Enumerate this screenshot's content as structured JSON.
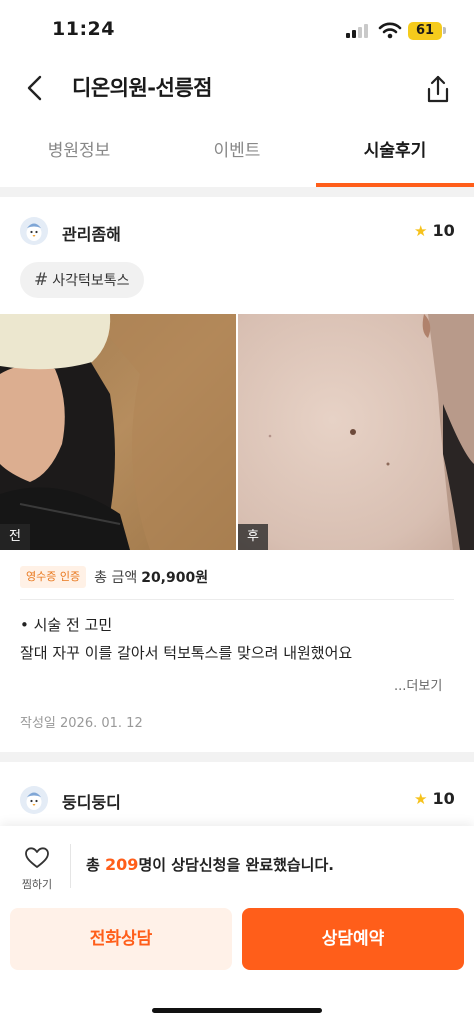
{
  "status_bar": {
    "time": "11:24",
    "battery": "61",
    "battery_color": "#f5cb1c"
  },
  "header": {
    "title": "디온의원-선릉점",
    "back_icon": "chevron-left-icon",
    "share_icon": "share-icon"
  },
  "tabs": [
    {
      "label": "병원정보",
      "active": false
    },
    {
      "label": "이벤트",
      "active": false
    },
    {
      "label": "시술후기",
      "active": true
    }
  ],
  "accent_color": "#ff5e1a",
  "reviews": [
    {
      "author": "관리좀해",
      "rating": "10",
      "hashtag": "사각턱보톡스",
      "photo_before_label": "전",
      "photo_after_label": "후",
      "receipt_badge": "영수증 인증",
      "price_label": "총 금액",
      "price_value": "20,900원",
      "heading": "• 시술 전 고민",
      "body": "잘대 자꾸 이를 갈아서 턱보톡스를 맞으려 내원했어요",
      "more": "...더보기",
      "date": "작성일 2026. 01. 12"
    },
    {
      "author": "둥디둥디",
      "rating": "10"
    }
  ],
  "bottom_bar": {
    "like_label": "찜하기",
    "consult_prefix": "총 ",
    "consult_count": "209",
    "consult_suffix": "명이 상담신청을 완료했습니다.",
    "phone_button": "전화상담",
    "reserve_button": "상담예약"
  }
}
